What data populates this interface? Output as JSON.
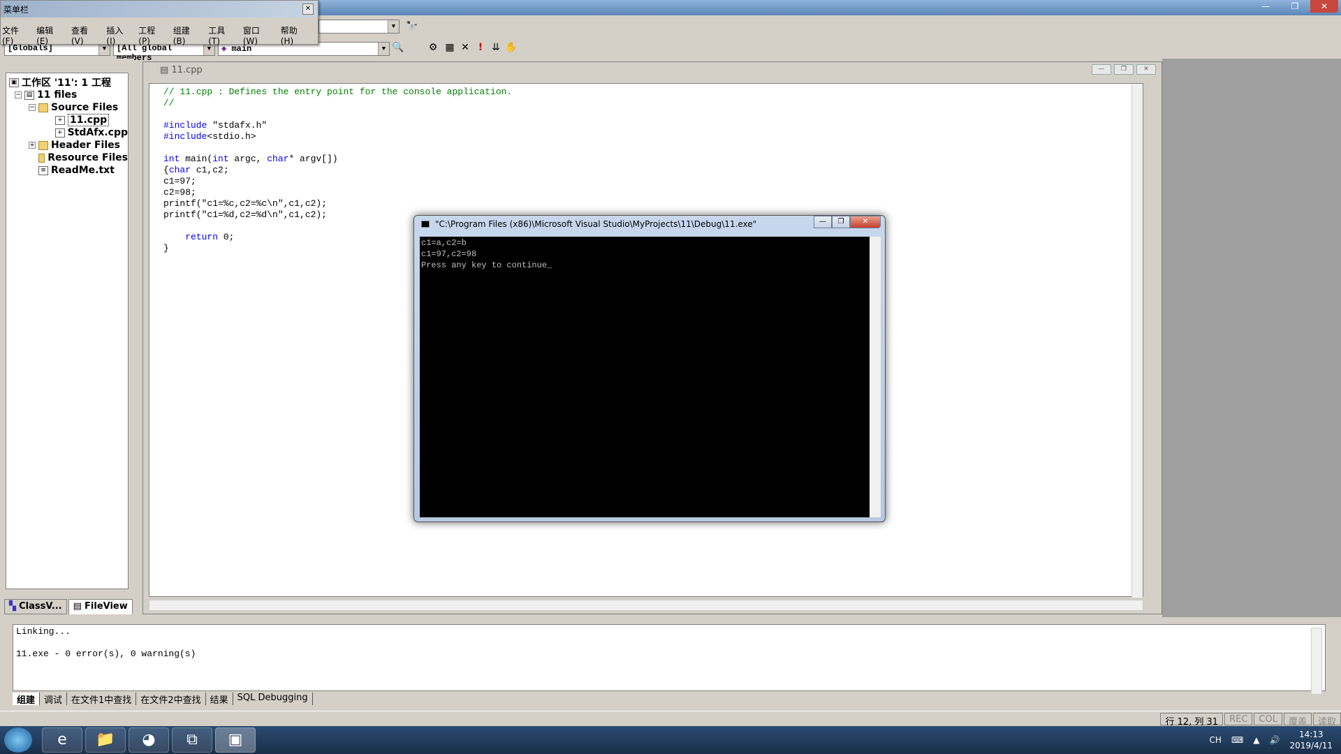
{
  "menu": {
    "caption": "菜单栏",
    "items": [
      "文件(F)",
      "编辑(E)",
      "查看(V)",
      "插入(I)",
      "工程(P)",
      "组建(B)",
      "工具(T)",
      "窗口(W)",
      "帮助(H)"
    ]
  },
  "toolbar": {
    "globals": "[Globals]",
    "members": "[All global members",
    "function": "main"
  },
  "workspace": {
    "root": "工作区 '11': 1 工程",
    "project": "11 files",
    "source_folder": "Source Files",
    "file_selected": "11.cpp",
    "file2": "StdAfx.cpp",
    "header_folder": "Header Files",
    "resource_folder": "Resource Files",
    "readme": "ReadMe.txt",
    "tab_class": "ClassV...",
    "tab_file": "FileView"
  },
  "editor": {
    "title": "11.cpp",
    "lines": [
      {
        "cls": "cm",
        "text": "// 11.cpp : Defines the entry point for the console application."
      },
      {
        "cls": "cm",
        "text": "//"
      },
      {
        "cls": "",
        "text": ""
      },
      {
        "cls": "",
        "text": "#include \"stdafx.h\""
      },
      {
        "cls": "",
        "text": "#include<stdio.h>"
      },
      {
        "cls": "",
        "text": ""
      },
      {
        "cls": "",
        "text": "int main(int argc, char* argv[])"
      },
      {
        "cls": "",
        "text": "{char c1,c2;"
      },
      {
        "cls": "",
        "text": "c1=97;"
      },
      {
        "cls": "",
        "text": "c2=98;"
      },
      {
        "cls": "",
        "text": "printf(\"c1=%c,c2=%c\\n\",c1,c2);"
      },
      {
        "cls": "",
        "text": "printf(\"c1=%d,c2=%d\\n\",c1,c2);"
      },
      {
        "cls": "",
        "text": ""
      },
      {
        "cls": "",
        "text": "    return 0;"
      },
      {
        "cls": "",
        "text": "}"
      }
    ]
  },
  "console": {
    "title": "\"C:\\Program Files (x86)\\Microsoft Visual Studio\\MyProjects\\11\\Debug\\11.exe\"",
    "lines": [
      "c1=a,c2=b",
      "c1=97,c2=98",
      "Press any key to continue_"
    ]
  },
  "output": {
    "lines": [
      "Linking...",
      "",
      "11.exe - 0 error(s), 0 warning(s)"
    ],
    "tabs": [
      "组建",
      "调试",
      "在文件1中查找",
      "在文件2中查找",
      "结果",
      "SQL Debugging"
    ]
  },
  "status": {
    "position": "行 12, 列 31",
    "rec": "REC",
    "col": "COL",
    "ovr": "覆盖",
    "read": "读取"
  },
  "taskbar": {
    "lang": "CH",
    "time": "14:13",
    "date": "2019/4/11"
  }
}
